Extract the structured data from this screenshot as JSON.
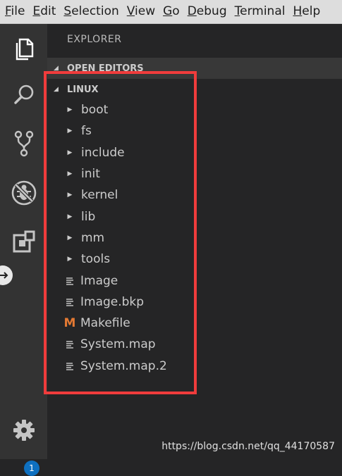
{
  "menubar": {
    "items": [
      {
        "mnemonic": "F",
        "rest": "ile"
      },
      {
        "mnemonic": "E",
        "rest": "dit"
      },
      {
        "mnemonic": "S",
        "rest": "election"
      },
      {
        "mnemonic": "V",
        "rest": "iew"
      },
      {
        "mnemonic": "G",
        "rest": "o"
      },
      {
        "mnemonic": "D",
        "rest": "ebug"
      },
      {
        "mnemonic": "T",
        "rest": "erminal"
      },
      {
        "mnemonic": "H",
        "rest": "elp"
      }
    ]
  },
  "activitybar": {
    "icons": [
      "files-icon",
      "search-icon",
      "source-control-icon",
      "debug-icon",
      "extensions-icon"
    ],
    "settings_icon": "gear-icon",
    "settings_badge": "1"
  },
  "explorer": {
    "title": "EXPLORER",
    "open_editors_label": "OPEN EDITORS",
    "folder_label": "LINUX",
    "folders": [
      "boot",
      "fs",
      "include",
      "init",
      "kernel",
      "lib",
      "mm",
      "tools"
    ],
    "files": [
      {
        "name": "Image",
        "icon": "text-file-icon"
      },
      {
        "name": "Image.bkp",
        "icon": "text-file-icon"
      },
      {
        "name": "Makefile",
        "icon": "makefile-icon"
      },
      {
        "name": "System.map",
        "icon": "text-file-icon"
      },
      {
        "name": "System.map.2",
        "icon": "text-file-icon"
      }
    ]
  },
  "colors": {
    "highlight_border": "#f03c3c",
    "makefile_icon": "#e37933",
    "badge": "#0e70c0"
  },
  "watermark": "https://blog.csdn.net/qq_44170587"
}
